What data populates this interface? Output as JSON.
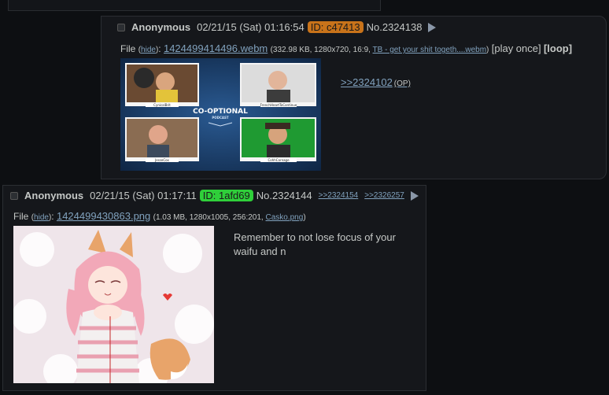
{
  "post1": {
    "name": "Anonymous",
    "datetime": "02/21/15 (Sat) 01:16:54",
    "poster_id": "ID: c47413",
    "id_color": "#c8731a",
    "post_no": "No.2324138",
    "file_prefix": "File",
    "hide_label": "hide",
    "filename": "1424499414496.webm",
    "file_meta_open": "(332.98 KB, 1280x720, 16:9,",
    "orig_name": "TB - get your shit togeth....webm",
    "file_meta_close": ")",
    "play_once": "[play once]",
    "loop": "[loop]",
    "quote": ">>2324102",
    "op_label": "(OP)",
    "thumb": {
      "podcast_title": "CO-OPTIONAL",
      "podcast_sub": "PODCAST",
      "labels": [
        "CynicalBrit",
        "FrenchHeartToContinue",
        "JesseCox",
        "CohhCarnage"
      ]
    }
  },
  "post2": {
    "name": "Anonymous",
    "datetime": "02/21/15 (Sat) 01:17:11",
    "poster_id": "ID: 1afd69",
    "id_color": "#2fcf3a",
    "post_no": "No.2324144",
    "backlinks": [
      ">>2324154",
      ">>2326257"
    ],
    "file_prefix": "File",
    "hide_label": "hide",
    "filename": "1424499430863.png",
    "file_meta_open": "(1.03 MB, 1280x1005, 256:201,",
    "orig_name": "Casko.png",
    "file_meta_close": ")",
    "comment": "Remember to not lose focus of your waifu and n"
  }
}
